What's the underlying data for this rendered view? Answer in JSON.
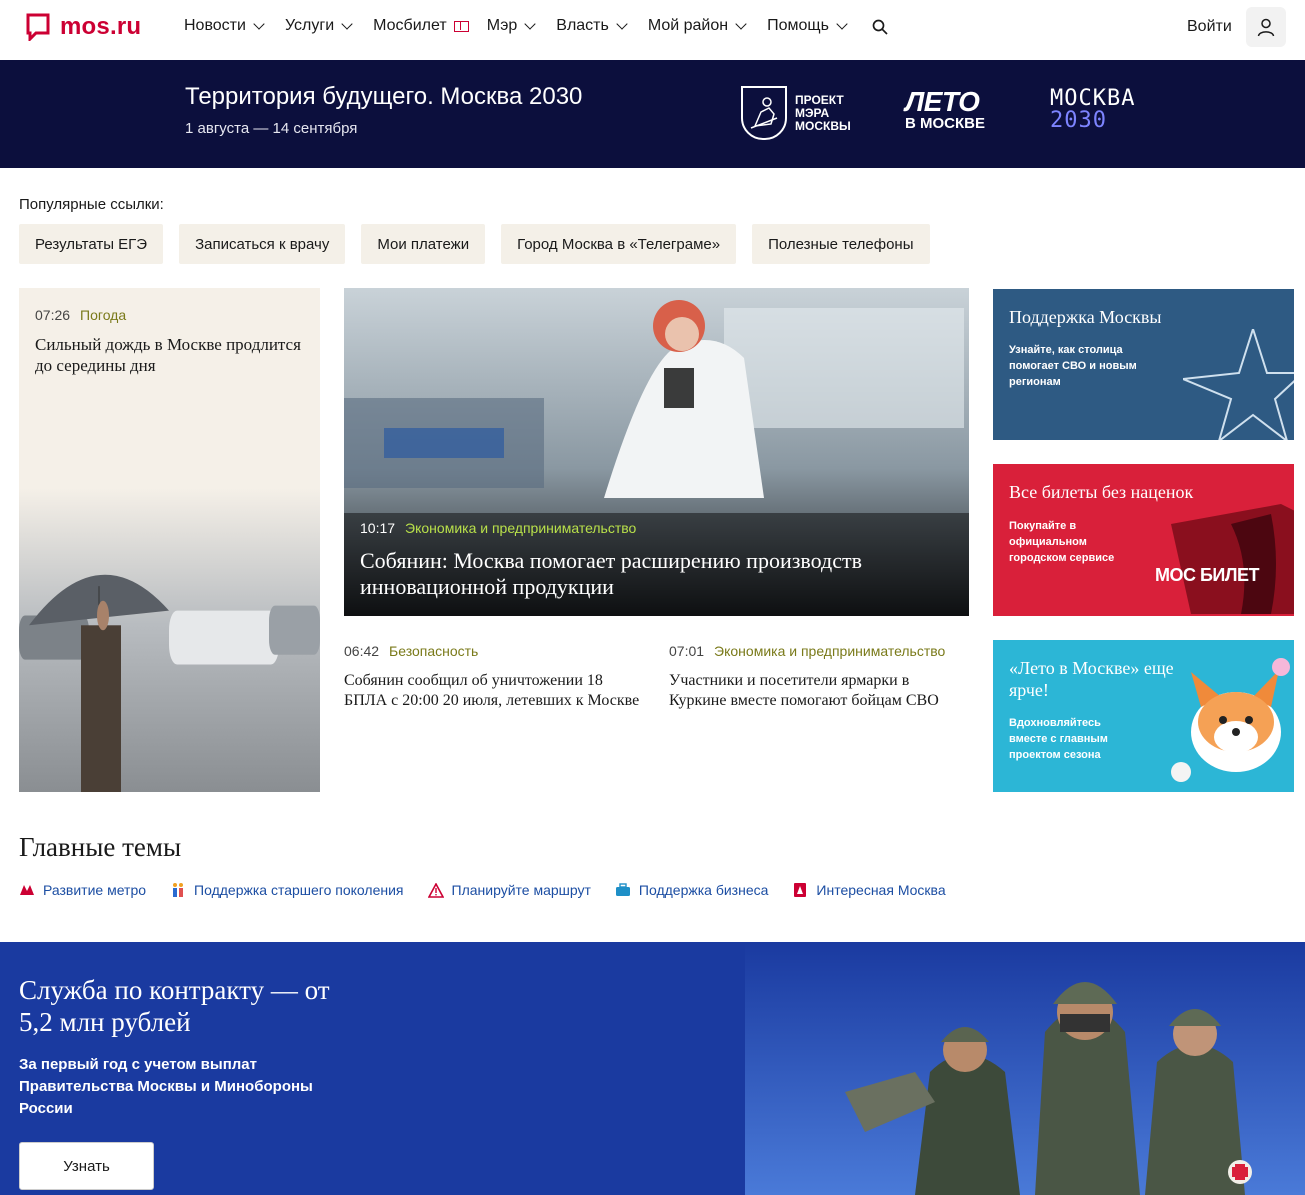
{
  "header": {
    "logo_text": "mos.ru",
    "nav": [
      {
        "label": "Новости"
      },
      {
        "label": "Услуги"
      },
      {
        "label": "Мосбилет"
      },
      {
        "label": "Мэр"
      },
      {
        "label": "Власть"
      },
      {
        "label": "Мой район"
      },
      {
        "label": "Помощь"
      }
    ],
    "login": "Войти"
  },
  "banner": {
    "title": "Территория будущего. Москва 2030",
    "subtitle": "1 августа — 14 сентября",
    "project_label": "ПРОЕКТ МЭРА МОСКВЫ",
    "leto_big": "ЛЕТО",
    "leto_small": "В МОСКВЕ",
    "moscow_2030_top": "МОСКВА",
    "moscow_2030_bottom": "2030"
  },
  "popular": {
    "label": "Популярные ссылки:",
    "links": [
      "Результаты ЕГЭ",
      "Записаться к врачу",
      "Мои платежи",
      "Город Москва в «Телеграме»",
      "Полезные телефоны"
    ]
  },
  "weather_card": {
    "time": "07:26",
    "category": "Погода",
    "title": "Сильный дождь в Москве продлится до середины дня"
  },
  "main_news": {
    "time": "10:17",
    "category": "Экономика и предпринимательство",
    "title": "Собянин: Москва помогает расширению производств инновационной продукции"
  },
  "news": [
    {
      "time": "06:42",
      "category": "Безопасность",
      "title": "Собянин сообщил об уничтожении 18 БПЛА с 20:00 20 июля, летевших к Москве"
    },
    {
      "time": "07:01",
      "category": "Экономика и предпринимательство",
      "title": "Участники и посетители ярмарки в Куркине вместе помогают бойцам СВО"
    }
  ],
  "promos": [
    {
      "title": "Поддержка Москвы",
      "text": "Узнайте, как столица помогает СВО и новым регионам",
      "color": "#2e5a83"
    },
    {
      "title": "Все билеты без наценок",
      "text": "Покупайте в официальном городском сервисе",
      "logo": "МОС БИЛЕТ",
      "color": "#d9203a"
    },
    {
      "title": "«Лето в Москве» еще ярче!",
      "text": "Вдохновляйтесь вместе с главным проектом сезона",
      "color": "#2cb6d6"
    }
  ],
  "themes": {
    "title": "Главные темы",
    "items": [
      {
        "label": "Развитие метро",
        "icon": "metro-icon"
      },
      {
        "label": "Поддержка старшего поколения",
        "icon": "elderly-icon"
      },
      {
        "label": "Планируйте маршрут",
        "icon": "warning-icon"
      },
      {
        "label": "Поддержка бизнеса",
        "icon": "briefcase-icon"
      },
      {
        "label": "Интересная Москва",
        "icon": "landmark-icon"
      }
    ]
  },
  "svo": {
    "title": "Служба по контракту — от 5,2 млн рублей",
    "text": "За первый год с учетом выплат Правительства Москвы и Минобороны России",
    "button": "Узнать"
  }
}
